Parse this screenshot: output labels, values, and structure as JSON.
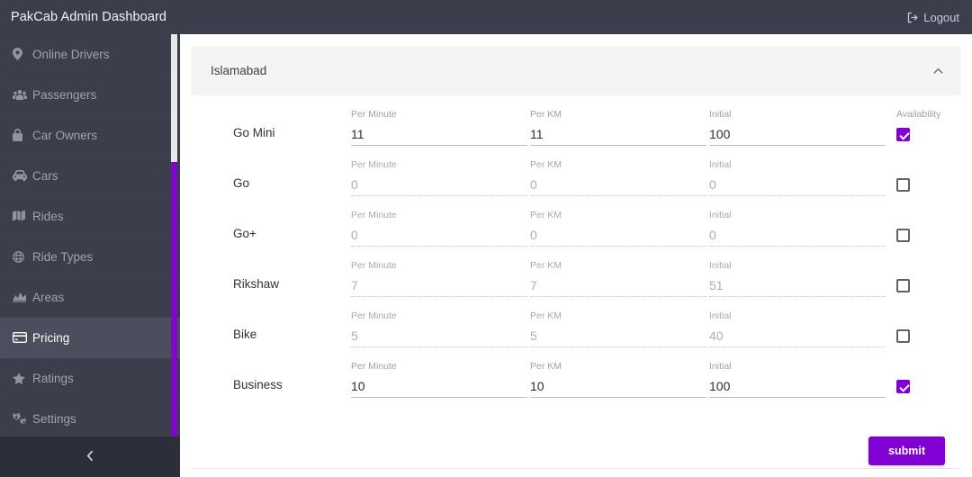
{
  "header": {
    "brand": "PakCab Admin Dashboard",
    "logout_label": "Logout",
    "logout_icon": "sign-out-icon",
    "bg_color": "#3a3f4b"
  },
  "sidebar": {
    "bg_color": "#3a3f4b",
    "active_bg_color": "#4b4f5d",
    "scrollbar_color": "#7b09c7",
    "collapse_icon": "chevron-left-icon",
    "items": [
      {
        "label": "Online Drivers",
        "icon": "map-marker-icon",
        "active": false
      },
      {
        "label": "Passengers",
        "icon": "users-icon",
        "active": false
      },
      {
        "label": "Car Owners",
        "icon": "lock-icon",
        "active": false
      },
      {
        "label": "Cars",
        "icon": "car-icon",
        "active": false
      },
      {
        "label": "Rides",
        "icon": "map-icon",
        "active": false
      },
      {
        "label": "Ride Types",
        "icon": "globe-icon",
        "active": false
      },
      {
        "label": "Areas",
        "icon": "chart-area-icon",
        "active": false
      },
      {
        "label": "Pricing",
        "icon": "credit-card-icon",
        "active": true
      },
      {
        "label": "Ratings",
        "icon": "star-icon",
        "active": false
      },
      {
        "label": "Settings",
        "icon": "cogs-icon",
        "active": false
      }
    ]
  },
  "main": {
    "accordion": {
      "title": "Islamabad",
      "chevron_icon": "chevron-up-icon",
      "expanded": true
    },
    "columns": {
      "per_minute": "Per Minute",
      "per_km": "Per KM",
      "initial": "Initial",
      "availability": "Availability"
    },
    "rows": [
      {
        "name": "Go Mini",
        "per_minute": "11",
        "per_km": "11",
        "initial": "100",
        "available": true,
        "enabled": true
      },
      {
        "name": "Go",
        "per_minute": "0",
        "per_km": "0",
        "initial": "0",
        "available": false,
        "enabled": false
      },
      {
        "name": "Go+",
        "per_minute": "0",
        "per_km": "0",
        "initial": "0",
        "available": false,
        "enabled": false
      },
      {
        "name": "Rikshaw",
        "per_minute": "7",
        "per_km": "7",
        "initial": "51",
        "available": false,
        "enabled": false
      },
      {
        "name": "Bike",
        "per_minute": "5",
        "per_km": "5",
        "initial": "40",
        "available": false,
        "enabled": false
      },
      {
        "name": "Business",
        "per_minute": "10",
        "per_km": "10",
        "initial": "100",
        "available": true,
        "enabled": true
      }
    ],
    "submit_label": "submit",
    "accent_color": "#8100d4"
  }
}
